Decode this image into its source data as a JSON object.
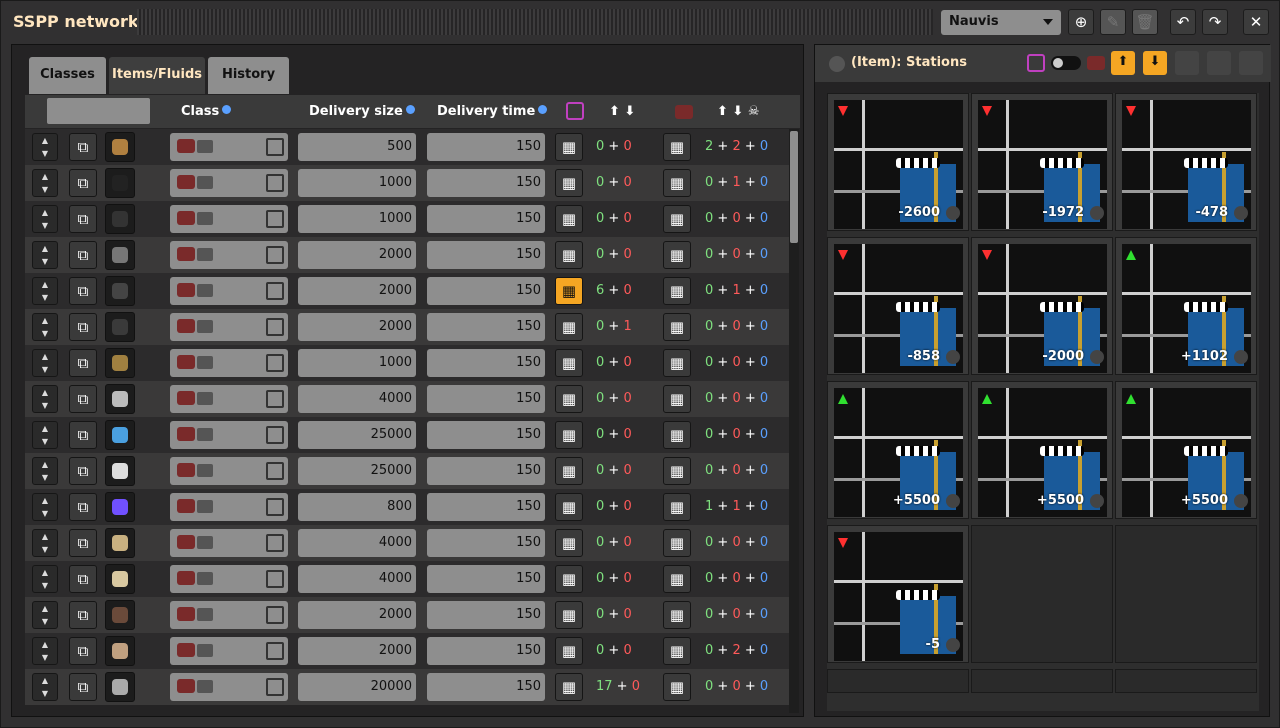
{
  "window": {
    "title": "SSPP network",
    "surface": "Nauvis"
  },
  "tabs": [
    "Classes",
    "Items/Fluids",
    "History"
  ],
  "columns": {
    "class": "Class",
    "delivery_size": "Delivery size",
    "delivery_time": "Delivery time"
  },
  "rows": [
    {
      "size": "500",
      "time": "150",
      "a1": "0",
      "a2": "0",
      "b1": "2",
      "b2": "2",
      "b3": "0"
    },
    {
      "size": "1000",
      "time": "150",
      "a1": "0",
      "a2": "0",
      "b1": "0",
      "b2": "1",
      "b3": "0"
    },
    {
      "size": "1000",
      "time": "150",
      "a1": "0",
      "a2": "0",
      "b1": "0",
      "b2": "0",
      "b3": "0"
    },
    {
      "size": "2000",
      "time": "150",
      "a1": "0",
      "a2": "0",
      "b1": "0",
      "b2": "0",
      "b3": "0"
    },
    {
      "size": "2000",
      "time": "150",
      "a1": "6",
      "a2": "0",
      "b1": "0",
      "b2": "1",
      "b3": "0"
    },
    {
      "size": "2000",
      "time": "150",
      "a1": "0",
      "a2": "1",
      "b1": "0",
      "b2": "0",
      "b3": "0"
    },
    {
      "size": "1000",
      "time": "150",
      "a1": "0",
      "a2": "0",
      "b1": "0",
      "b2": "0",
      "b3": "0"
    },
    {
      "size": "4000",
      "time": "150",
      "a1": "0",
      "a2": "0",
      "b1": "0",
      "b2": "0",
      "b3": "0"
    },
    {
      "size": "25000",
      "time": "150",
      "a1": "0",
      "a2": "0",
      "b1": "0",
      "b2": "0",
      "b3": "0"
    },
    {
      "size": "25000",
      "time": "150",
      "a1": "0",
      "a2": "0",
      "b1": "0",
      "b2": "0",
      "b3": "0"
    },
    {
      "size": "800",
      "time": "150",
      "a1": "0",
      "a2": "0",
      "b1": "1",
      "b2": "1",
      "b3": "0"
    },
    {
      "size": "4000",
      "time": "150",
      "a1": "0",
      "a2": "0",
      "b1": "0",
      "b2": "0",
      "b3": "0"
    },
    {
      "size": "4000",
      "time": "150",
      "a1": "0",
      "a2": "0",
      "b1": "0",
      "b2": "0",
      "b3": "0"
    },
    {
      "size": "2000",
      "time": "150",
      "a1": "0",
      "a2": "0",
      "b1": "0",
      "b2": "0",
      "b3": "0"
    },
    {
      "size": "2000",
      "time": "150",
      "a1": "0",
      "a2": "0",
      "b1": "0",
      "b2": "2",
      "b3": "0"
    },
    {
      "size": "20000",
      "time": "150",
      "a1": "17",
      "a2": "0",
      "b1": "0",
      "b2": "0",
      "b3": "0"
    }
  ],
  "item_icons": [
    "wooden-chest-icon",
    "coal-icon",
    "coal-pile-icon",
    "stone-icon",
    "coal-ore-icon",
    "iron-plate-icon",
    "copper-ore-icon",
    "stone-pile-icon",
    "water-drop-icon",
    "spheres-icon",
    "purple-crystal-icon",
    "sand-icon",
    "sand-icon",
    "dark-ore-icon",
    "tan-ore-icon",
    "gray-ore-icon"
  ],
  "right_panel": {
    "title": "(Item): Stations",
    "stations": [
      {
        "value": "-2600",
        "dir": "down"
      },
      {
        "value": "-1972",
        "dir": "down"
      },
      {
        "value": "-478",
        "dir": "down"
      },
      {
        "value": "-858",
        "dir": "down"
      },
      {
        "value": "-2000",
        "dir": "down"
      },
      {
        "value": "+1102",
        "dir": "up"
      },
      {
        "value": "+5500",
        "dir": "up"
      },
      {
        "value": "+5500",
        "dir": "up"
      },
      {
        "value": "+5500",
        "dir": "up"
      },
      {
        "value": "-5",
        "dir": "down"
      }
    ]
  },
  "colors": {
    "provide": "#7fe07f",
    "request": "#ff5a5a",
    "neutral": "#5aa0ff",
    "highlight": "#f5a623"
  }
}
